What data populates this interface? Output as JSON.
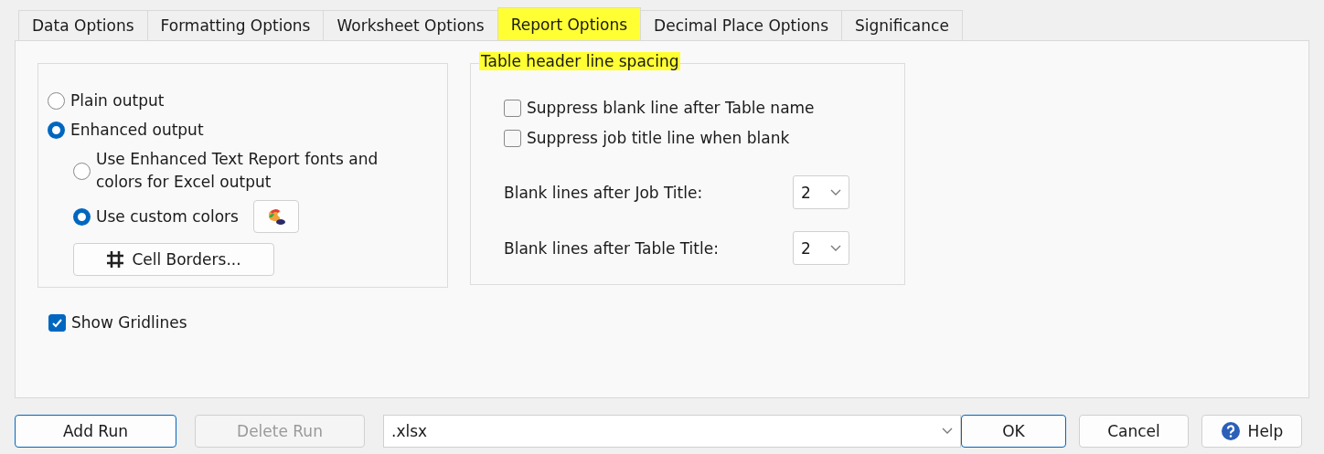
{
  "tabs": [
    {
      "label": "Data Options",
      "selected": false
    },
    {
      "label": "Formatting Options",
      "selected": false
    },
    {
      "label": "Worksheet Options",
      "selected": false
    },
    {
      "label": "Report Options",
      "selected": true
    },
    {
      "label": "Decimal Place Options",
      "selected": false
    },
    {
      "label": "Significance",
      "selected": false
    }
  ],
  "output_group": {
    "options": [
      {
        "label": "Plain output",
        "selected": false
      },
      {
        "label": "Enhanced output",
        "selected": true,
        "children": [
          {
            "label": "Use Enhanced Text Report fonts and colors for Excel output",
            "selected": false
          },
          {
            "label": "Use custom colors",
            "selected": true
          }
        ]
      }
    ],
    "cell_borders_button": "Cell Borders..."
  },
  "show_gridlines": {
    "label": "Show Gridlines",
    "checked": true
  },
  "spacing_group": {
    "title": "Table header line spacing",
    "checkboxes": [
      {
        "label": "Suppress blank line after Table name",
        "checked": false
      },
      {
        "label": "Suppress job title line when blank",
        "checked": false
      }
    ],
    "dropdowns": [
      {
        "label": "Blank lines after Job Title:",
        "value": "2"
      },
      {
        "label": "Blank lines after Table Title:",
        "value": "2"
      }
    ]
  },
  "footer": {
    "add_run": "Add Run",
    "delete_run": {
      "label": "Delete Run",
      "disabled": true
    },
    "format": ".xlsx",
    "ok": "OK",
    "cancel": "Cancel",
    "help": "Help"
  }
}
